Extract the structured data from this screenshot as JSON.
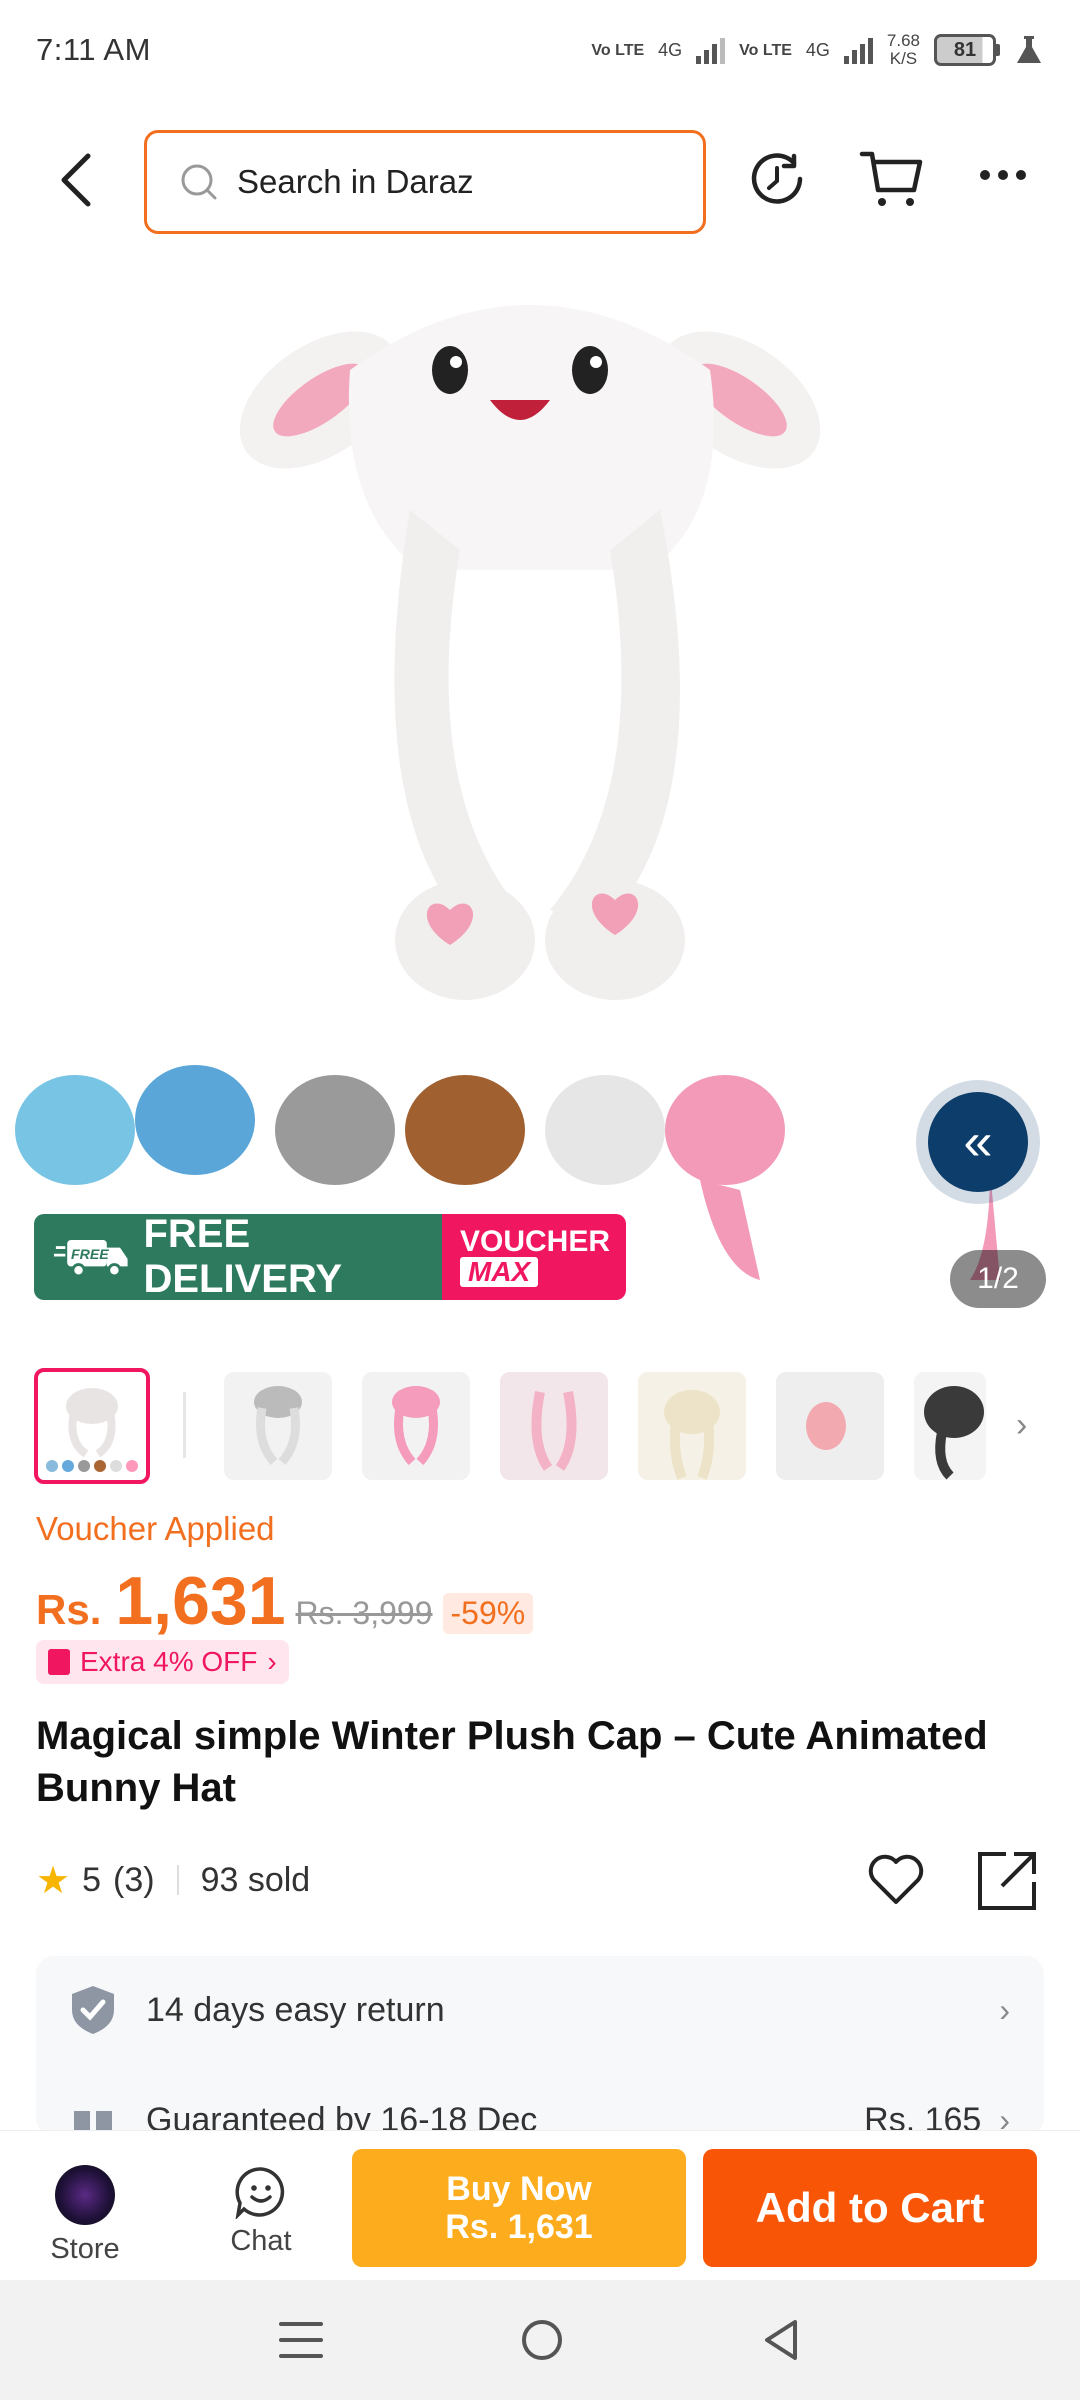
{
  "status": {
    "time": "7:11 AM",
    "net1": "Vo LTE",
    "net1_gen": "4G",
    "net2": "Vo LTE",
    "net2_gen": "4G",
    "speed_value": "7.68",
    "speed_unit": "K/S",
    "battery": "81"
  },
  "header": {
    "search_placeholder": "Search in Daraz"
  },
  "gallery": {
    "page_indicator": "1/2",
    "promo_free": "FREE DELIVERY",
    "promo_free_tag": "FREE",
    "promo_voucher_1": "VOUCHER",
    "promo_voucher_2": "MAX"
  },
  "product": {
    "voucher_applied": "Voucher Applied",
    "currency": "Rs.",
    "price": "1,631",
    "old_price": "Rs. 3,999",
    "discount": "-59%",
    "extra_off": "Extra 4% OFF",
    "title": "Magical simple  Winter Plush Cap – Cute Animated Bunny Hat",
    "rating": "5",
    "reviews": "(3)",
    "sold": "93 sold"
  },
  "services": [
    {
      "label": "14 days easy return"
    },
    {
      "label": "Guaranteed by 16-18 Dec",
      "fee": "Rs. 165"
    }
  ],
  "bottom": {
    "store_label": "Store",
    "chat_label": "Chat",
    "buy_now_1": "Buy Now",
    "buy_now_2": "Rs. 1,631",
    "add_to_cart": "Add to Cart"
  },
  "colors": {
    "accent": "#f36f20",
    "pink": "#f0165f",
    "buy_now": "#fcac1c",
    "add_to_cart": "#f85606",
    "free_delivery": "#2e7a5e"
  }
}
